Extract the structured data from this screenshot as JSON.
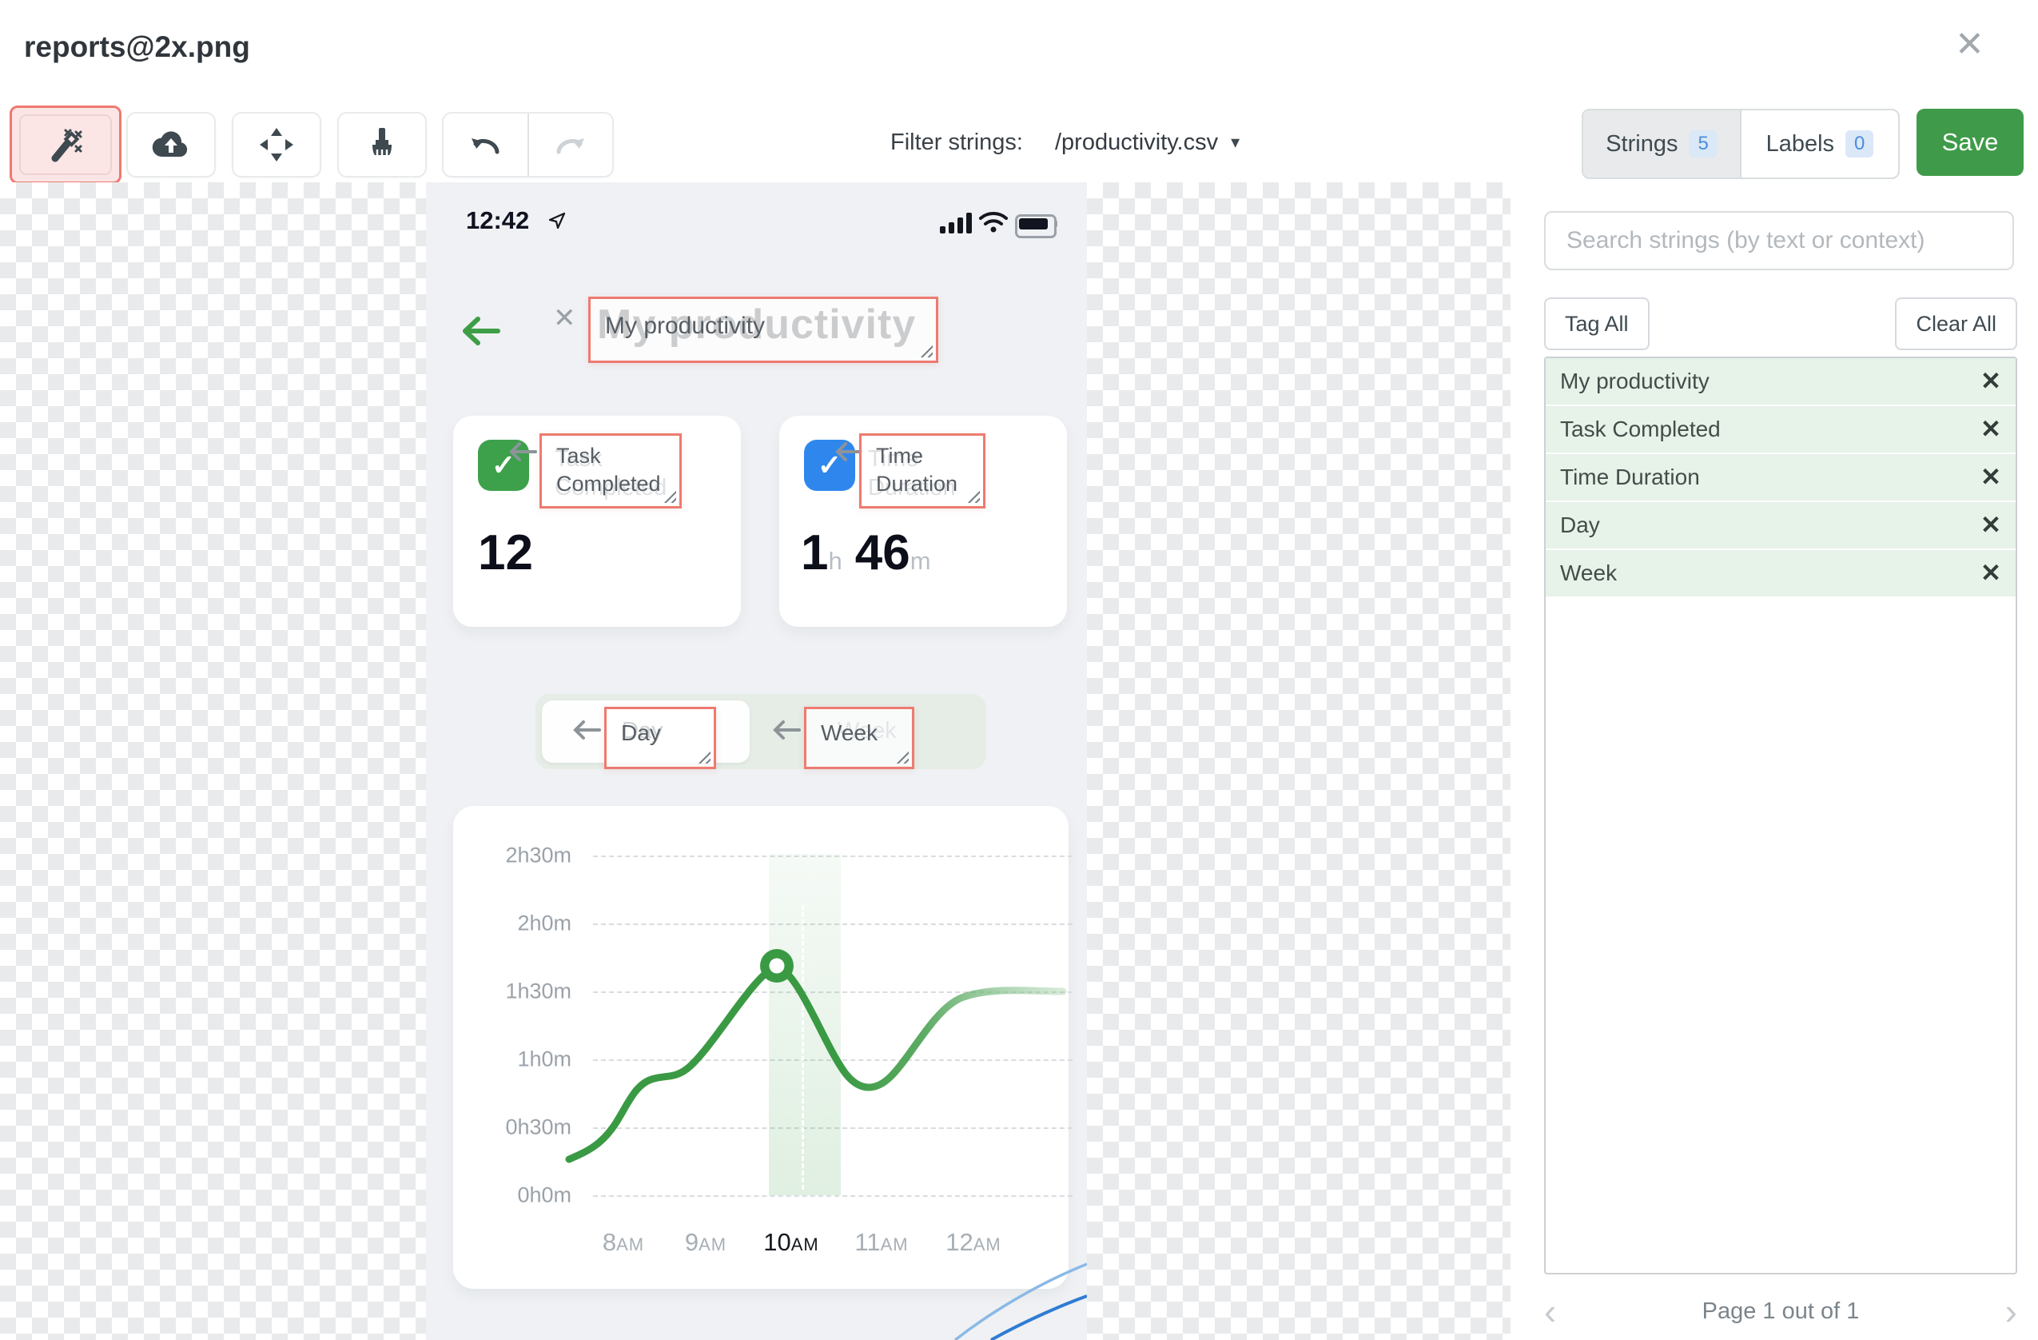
{
  "header": {
    "title": "reports@2x.png"
  },
  "toolbar": {
    "filter_label": "Filter strings:",
    "filter_value": "/productivity.csv",
    "strings_tab": "Strings",
    "strings_count": "5",
    "labels_tab": "Labels",
    "labels_count": "0",
    "save": "Save"
  },
  "canvas": {
    "phone": {
      "time": "12:42",
      "title": "My productivity",
      "card1_label": "Task Completed",
      "card1_value": "12",
      "card2_label": "Time Duration",
      "card2_hours": "1",
      "card2_hours_unit": "h",
      "card2_mins": "46",
      "card2_mins_unit": "m",
      "toggle_day": "Day",
      "toggle_week": "Week"
    },
    "annotations": {
      "title": "My productivity",
      "card1": "Task Completed",
      "card2": "Time Duration",
      "day": "Day",
      "week": "Week"
    },
    "chart_data": {
      "type": "line",
      "title": "",
      "x": [
        "8AM",
        "9AM",
        "10AM",
        "11AM",
        "12AM"
      ],
      "y_ticks": [
        "2h30m",
        "2h0m",
        "1h30m",
        "1h0m",
        "0h30m",
        "0h0m"
      ],
      "series": [
        {
          "name": "Time Duration",
          "values": [
            "0h25m",
            "1h10m",
            "1h45m",
            "0h50m",
            "1h30m"
          ]
        }
      ],
      "selected_x": "10AM",
      "ylim": [
        "0h0m",
        "2h30m"
      ],
      "grid": "dashed horizontal",
      "line_color": "#3a9a43"
    }
  },
  "sidebar": {
    "search_placeholder": "Search strings (by text or context)",
    "tag_all": "Tag All",
    "clear_all": "Clear All",
    "strings": [
      "My productivity",
      "Task Completed",
      "Time Duration",
      "Day",
      "Week"
    ],
    "pagination": "Page 1 out of 1"
  }
}
